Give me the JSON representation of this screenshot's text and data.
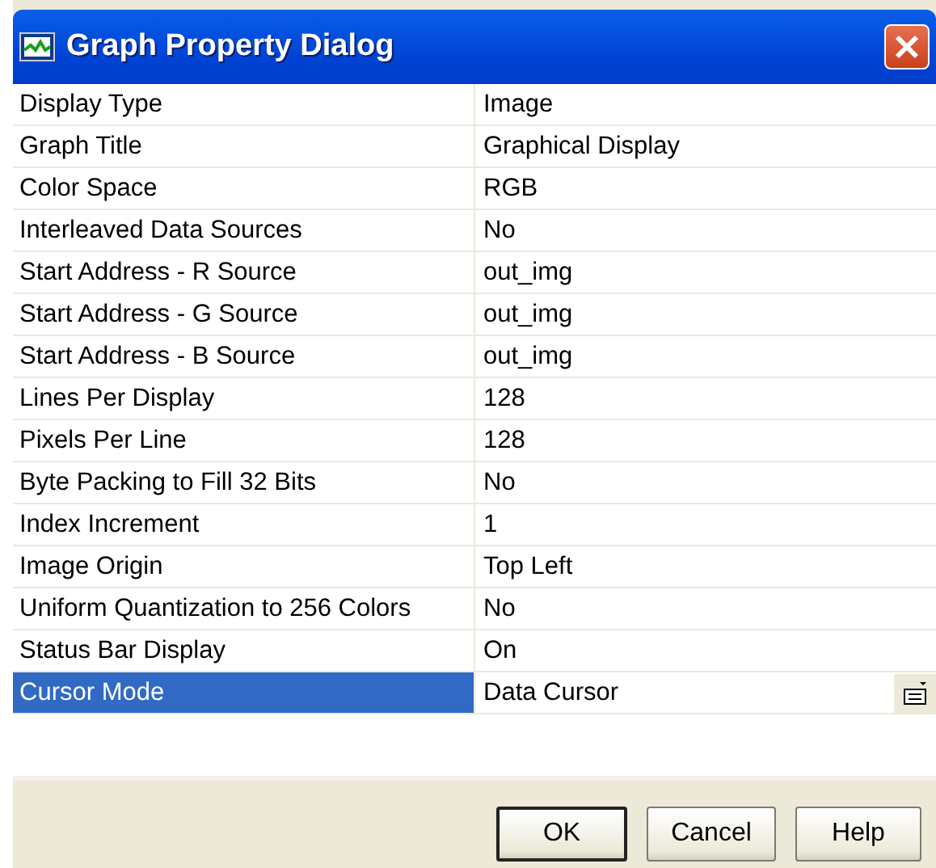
{
  "window": {
    "title": "Graph Property Dialog"
  },
  "properties": [
    {
      "name": "Display Type",
      "value": "Image",
      "selected": false,
      "kind": "text"
    },
    {
      "name": "Graph Title",
      "value": "Graphical Display",
      "selected": false,
      "kind": "text"
    },
    {
      "name": "Color Space",
      "value": "RGB",
      "selected": false,
      "kind": "text"
    },
    {
      "name": "Interleaved Data Sources",
      "value": "No",
      "selected": false,
      "kind": "text"
    },
    {
      "name": "Start Address - R Source",
      "value": "out_img",
      "selected": false,
      "kind": "text"
    },
    {
      "name": "Start Address - G Source",
      "value": "out_img",
      "selected": false,
      "kind": "text"
    },
    {
      "name": "Start Address - B Source",
      "value": "out_img",
      "selected": false,
      "kind": "text"
    },
    {
      "name": "Lines Per Display",
      "value": "128",
      "selected": false,
      "kind": "text"
    },
    {
      "name": "Pixels Per Line",
      "value": "128",
      "selected": false,
      "kind": "text"
    },
    {
      "name": "Byte Packing to Fill 32 Bits",
      "value": "No",
      "selected": false,
      "kind": "text"
    },
    {
      "name": "Index Increment",
      "value": "1",
      "selected": false,
      "kind": "text"
    },
    {
      "name": "Image Origin",
      "value": "Top Left",
      "selected": false,
      "kind": "text"
    },
    {
      "name": "Uniform Quantization to 256 Colors",
      "value": "No",
      "selected": false,
      "kind": "text"
    },
    {
      "name": "Status Bar Display",
      "value": "On",
      "selected": false,
      "kind": "text"
    },
    {
      "name": "Cursor Mode",
      "value": "Data Cursor",
      "selected": true,
      "kind": "dropdown"
    }
  ],
  "buttons": [
    {
      "label": "OK",
      "default": true
    },
    {
      "label": "Cancel",
      "default": false
    },
    {
      "label": "Help",
      "default": false
    }
  ]
}
